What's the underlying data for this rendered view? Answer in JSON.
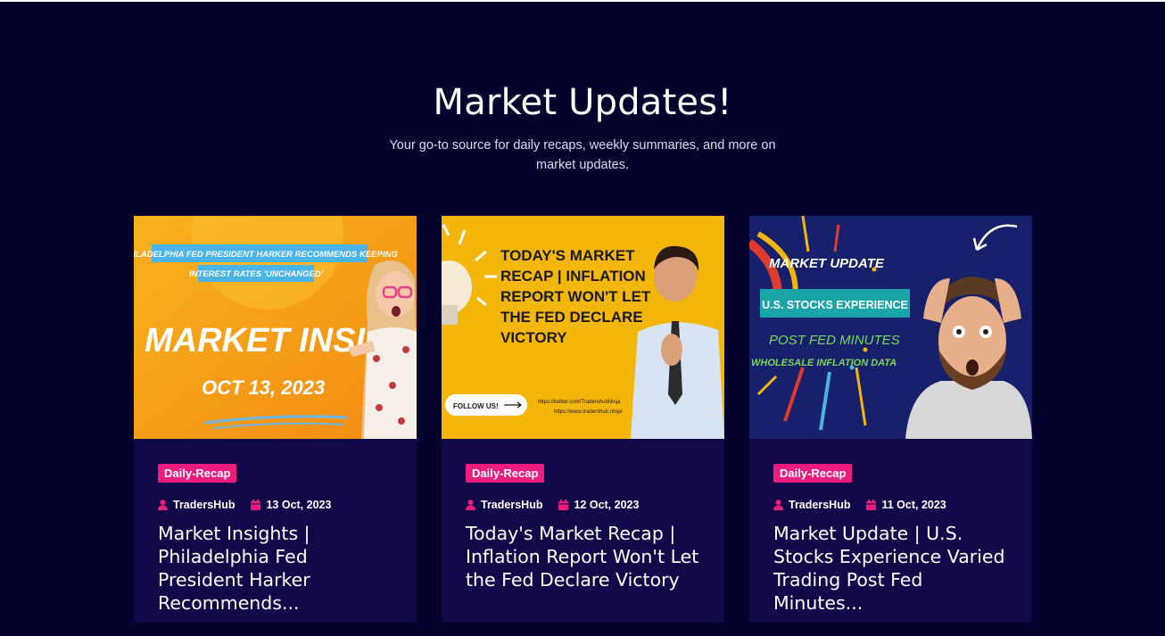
{
  "header": {
    "title": "Market Updates!",
    "subtitle": "Your go-to source for daily recaps, weekly summaries, and more on market updates."
  },
  "colors": {
    "background": "#03032e",
    "card_background": "#11084a",
    "tag": "#ee1d7d"
  },
  "cards": [
    {
      "image": {
        "banner": "PHILADELPHIA FED PRESIDENT HARKER RECOMMENDS KEEPING",
        "banner2": "INTEREST RATES 'UNCHANGED'",
        "headline": "MARKET INSIGHTS",
        "date": "OCT 13, 2023"
      },
      "tag": "Daily-Recap",
      "author": "TradersHub",
      "date": "13 Oct, 2023",
      "title": "Market Insights | Philadelphia Fed President Harker Recommends..."
    },
    {
      "image": {
        "line1": "TODAY'S MARKET",
        "line2": "RECAP | INFLATION",
        "line3": "REPORT WON'T LET",
        "line4": "THE FED DECLARE",
        "line5": "VICTORY",
        "follow": "FOLLOW US!",
        "link1": "https://twitter.com/TradershubNinja",
        "link2": "https://www.tradershub.ninja/"
      },
      "tag": "Daily-Recap",
      "author": "TradersHub",
      "date": "12 Oct, 2023",
      "title": "Today's Market Recap | Inflation Report Won't Let the Fed Declare Victory"
    },
    {
      "image": {
        "top": "MARKET UPDATE",
        "box": "U.S. STOCKS EXPERIENCE",
        "line1": "POST FED MINUTES",
        "line2": "WHOLESALE INFLATION DATA"
      },
      "tag": "Daily-Recap",
      "author": "TradersHub",
      "date": "11 Oct, 2023",
      "title": "Market Update | U.S. Stocks Experience Varied Trading Post Fed Minutes..."
    }
  ]
}
